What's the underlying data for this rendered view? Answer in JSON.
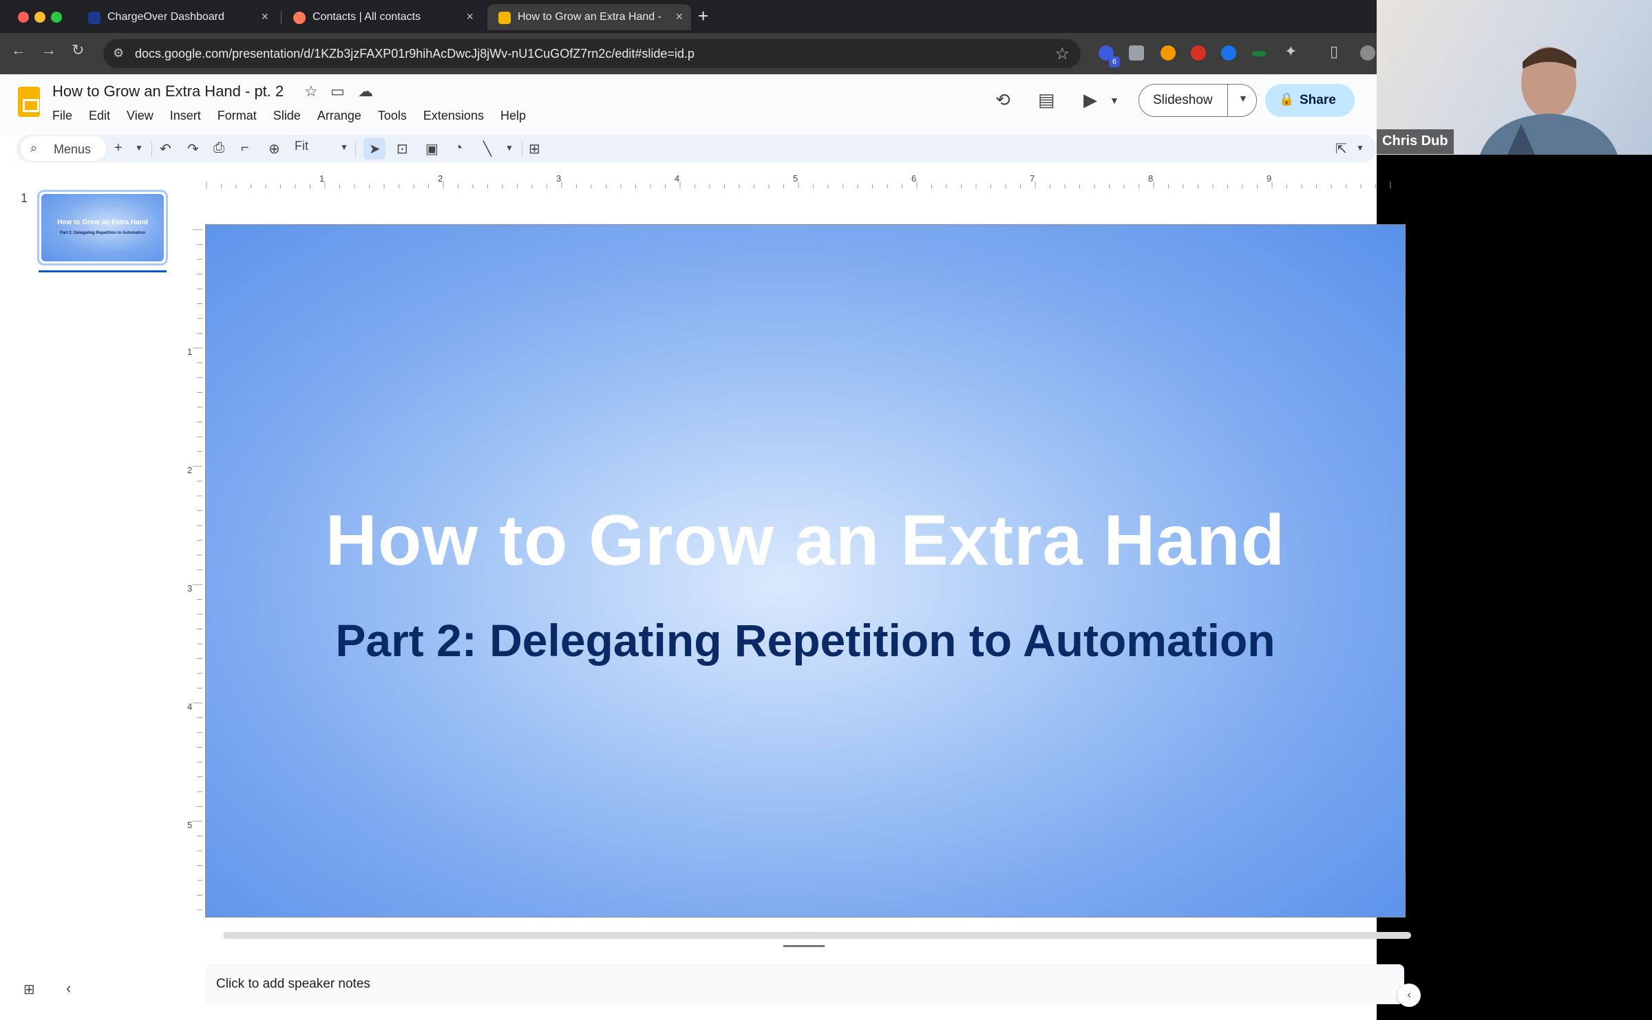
{
  "browser": {
    "tabs": [
      {
        "title": "ChargeOver Dashboard",
        "favicon_color": "#1a3a8f"
      },
      {
        "title": "Contacts | All contacts",
        "favicon_color": "#ff7a59"
      },
      {
        "title": "How to Grow an Extra Hand -",
        "favicon_color": "#f5b400"
      }
    ],
    "url": "docs.google.com/presentation/d/1KZb3jzFAXP01r9hihAcDwcJj8jWv-nU1CuGOfZ7rn2c/edit#slide=id.p",
    "extensions_badge": "6"
  },
  "app": {
    "doc_title": "How to Grow an Extra Hand - pt. 2",
    "menu": [
      "File",
      "Edit",
      "View",
      "Insert",
      "Format",
      "Slide",
      "Arrange",
      "Tools",
      "Extensions",
      "Help"
    ],
    "slideshow_label": "Slideshow",
    "share_label": "Share"
  },
  "toolbar": {
    "menus_label": "Menus",
    "zoom_label": "Fit"
  },
  "filmstrip": {
    "slide_number": "1",
    "thumb_title": "How to Grow an Extra Hand",
    "thumb_subtitle": "Part 2: Delegating Repetition to Automation"
  },
  "rulers": {
    "horizontal": [
      "1",
      "2",
      "3",
      "4",
      "5",
      "6",
      "7",
      "8",
      "9"
    ],
    "vertical": [
      "1",
      "2",
      "3",
      "4",
      "5"
    ]
  },
  "slide": {
    "title": "How to Grow an Extra Hand",
    "subtitle": "Part 2: Delegating Repetition to Automation",
    "title_color": "#ffffff",
    "subtitle_color": "#0a2a66"
  },
  "notes": {
    "placeholder": "Click to add speaker notes"
  },
  "webcam": {
    "name": "Chris Dub"
  }
}
